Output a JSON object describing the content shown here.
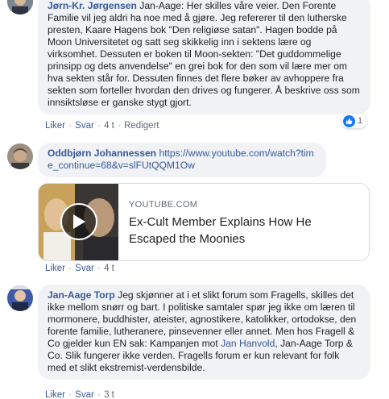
{
  "comments": [
    {
      "author": "Jørn-Kr. Jørgensen",
      "text": "Jan-Aage: Her skilles våre veier. Den Forente Familie vil jeg aldri ha noe med å gjøre. Jeg refererer til den lutherske presten, Kaare Hagens bok \"Den religiøse satan\". Hagen bodde på Moon Universitetet og satt seg skikkelig inn i sektens lære og virksomhet. Dessuten er boken til Moon-sekten: \"Det guddommelige prinsipp og dets anvendelse\" en grei bok for den som vil lære mer om hva sekten står for. Dessuten finnes det flere bøker av avhoppere fra sekten som forteller hvordan den drives og fungerer. Å beskrive oss som innsiktsløse er ganske stygt gjort.",
      "actions": {
        "like": "Liker",
        "reply": "Svar",
        "time": "4 t",
        "edited": "Redigert"
      },
      "reaction_count": "1"
    },
    {
      "author": "Oddbjørn Johannessen",
      "link_text": "https://www.youtube.com/watch?time_continue=68&v=slFUtQQM1Ow",
      "link_preview": {
        "domain": "YOUTUBE.COM",
        "title": "Ex-Cult Member Explains How He Escaped the Moonies"
      },
      "actions": {
        "like": "Liker",
        "reply": "Svar",
        "time": "4 t"
      }
    },
    {
      "author": "Jan-Aage Torp",
      "text_before": "Jeg skjønner at i et slikt forum som Fragells, skilles det ikke mellom snørr og bart. I politiske samtaler spør jeg ikke om læren til mormonere, buddhister, ateister, agnostikere, katolikker, ortodokse, den forente familie, lutheranere, pinsevenner eller annet. Men hos Fragell & Co gjelder kun EN sak: Kampanjen mot ",
      "mention": "Jan Hanvold",
      "text_after": ", Jan-Aage Torp & Co. Slik fungerer ikke verden. Fragells forum er kun relevant for folk med et slikt ekstremist-verdensbilde.",
      "actions": {
        "like": "Liker",
        "reply": "Svar",
        "time": "3 t"
      }
    }
  ],
  "colors": {
    "link": "#385898",
    "bubble": "#f0f2f5",
    "like": "#1877f2"
  }
}
